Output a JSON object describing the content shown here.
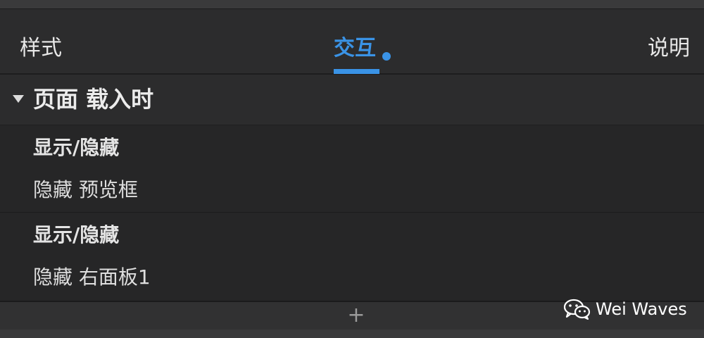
{
  "tabs": [
    {
      "label": "样式",
      "active": false
    },
    {
      "label": "交互",
      "active": true,
      "has_indicator": true
    },
    {
      "label": "说明",
      "active": false
    }
  ],
  "event": {
    "title": "页面 载入时",
    "expanded": true,
    "actions": [
      {
        "type": "显示/隐藏",
        "description": "隐藏 预览框"
      },
      {
        "type": "显示/隐藏",
        "description": "隐藏 右面板1"
      }
    ]
  },
  "footer": {
    "add_label": "+"
  },
  "watermark": {
    "text": "Wei Waves",
    "icon": "wechat-icon"
  },
  "colors": {
    "accent": "#3a93e6",
    "background": "#2b2b2c",
    "action_background": "#262627",
    "text": "#e6e6e6"
  }
}
